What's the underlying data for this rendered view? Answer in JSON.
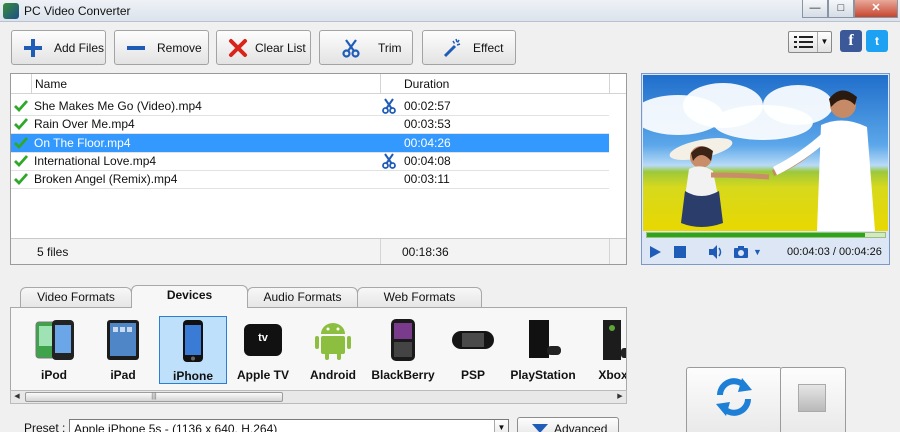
{
  "window": {
    "title": "PC Video Converter",
    "minimize": "—",
    "maximize": "□",
    "close": "✕"
  },
  "toolbar": {
    "buttons": [
      {
        "label": "Add Files",
        "icon": "plus-icon"
      },
      {
        "label": "Remove",
        "icon": "minus-icon"
      },
      {
        "label": "Clear List",
        "icon": "x-icon"
      },
      {
        "label": "Trim",
        "icon": "scissors-icon"
      },
      {
        "label": "Effect",
        "icon": "magic-wand-icon"
      }
    ],
    "facebook": "f",
    "twitter": "t"
  },
  "filelist": {
    "columns": {
      "name": "Name",
      "duration": "Duration"
    },
    "rows": [
      {
        "name": "She Makes Me Go (Video).mp4",
        "duration": "00:02:57",
        "trimmed": true,
        "selected": false
      },
      {
        "name": "Rain Over Me.mp4",
        "duration": "00:03:53",
        "trimmed": false,
        "selected": false
      },
      {
        "name": "On The Floor.mp4",
        "duration": "00:04:26",
        "trimmed": false,
        "selected": true
      },
      {
        "name": "International Love.mp4",
        "duration": "00:04:08",
        "trimmed": true,
        "selected": false
      },
      {
        "name": "Broken Angel (Remix).mp4",
        "duration": "00:03:11",
        "trimmed": false,
        "selected": false
      }
    ],
    "footer": {
      "count": "5 files",
      "total": "00:18:36"
    }
  },
  "preview": {
    "time": "00:04:03 / 00:04:26",
    "progress": 0.915
  },
  "tabs": [
    {
      "label": "Video Formats",
      "active": false
    },
    {
      "label": "Devices",
      "active": true
    },
    {
      "label": "Audio Formats",
      "active": false
    },
    {
      "label": "Web Formats",
      "active": false
    }
  ],
  "devices": [
    {
      "label": "iPod",
      "icon": "ipod-icon",
      "selected": false
    },
    {
      "label": "iPad",
      "icon": "ipad-icon",
      "selected": false
    },
    {
      "label": "iPhone",
      "icon": "iphone-icon",
      "selected": true
    },
    {
      "label": "Apple TV",
      "icon": "apple-tv-icon",
      "selected": false
    },
    {
      "label": "Android",
      "icon": "android-icon",
      "selected": false
    },
    {
      "label": "BlackBerry",
      "icon": "blackberry-icon",
      "selected": false
    },
    {
      "label": "PSP",
      "icon": "psp-icon",
      "selected": false
    },
    {
      "label": "PlayStation",
      "icon": "playstation-icon",
      "selected": false
    },
    {
      "label": "Xbox",
      "icon": "xbox-icon",
      "selected": false
    }
  ],
  "apple_tv_badge": "tv",
  "preset": {
    "label": "Preset :",
    "value": "Apple iPhone 5s - (1136 x 640, H.264)",
    "advanced_label": "Advanced"
  },
  "colors": {
    "selection": "#3399ff",
    "check": "#2ea828",
    "progress": "#2ca51a",
    "accent_blue": "#1f5cb8"
  }
}
